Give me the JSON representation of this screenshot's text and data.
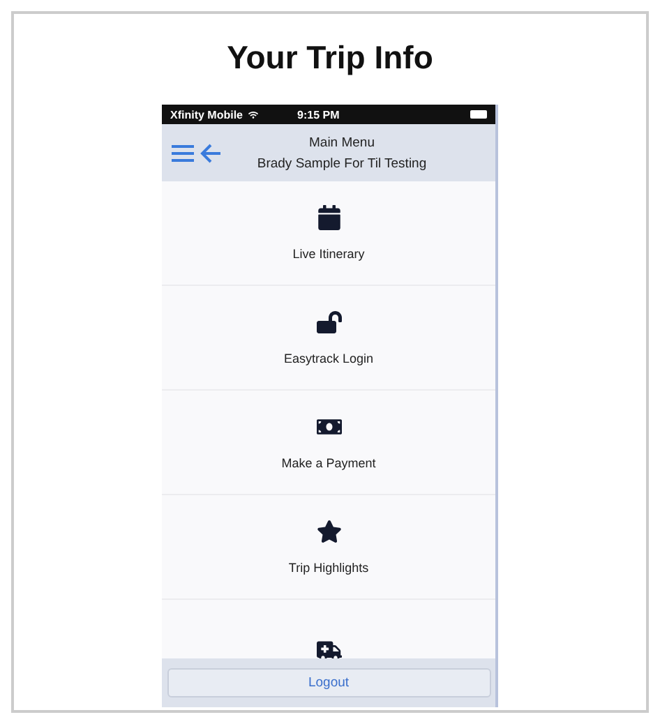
{
  "title": "Your Trip Info",
  "phone": {
    "status_bar": {
      "carrier": "Xfinity Mobile",
      "time": "9:15 PM"
    },
    "header": {
      "title": "Main Menu",
      "subtitle": "Brady Sample For Til Testing"
    },
    "menu_items": [
      {
        "kind": "calendar",
        "label": "Live Itinerary"
      },
      {
        "kind": "unlock",
        "label": "Easytrack Login"
      },
      {
        "kind": "money",
        "label": "Make a Payment"
      },
      {
        "kind": "star",
        "label": "Trip Highlights"
      },
      {
        "kind": "ambulance"
      }
    ],
    "logout_button": "Logout"
  }
}
